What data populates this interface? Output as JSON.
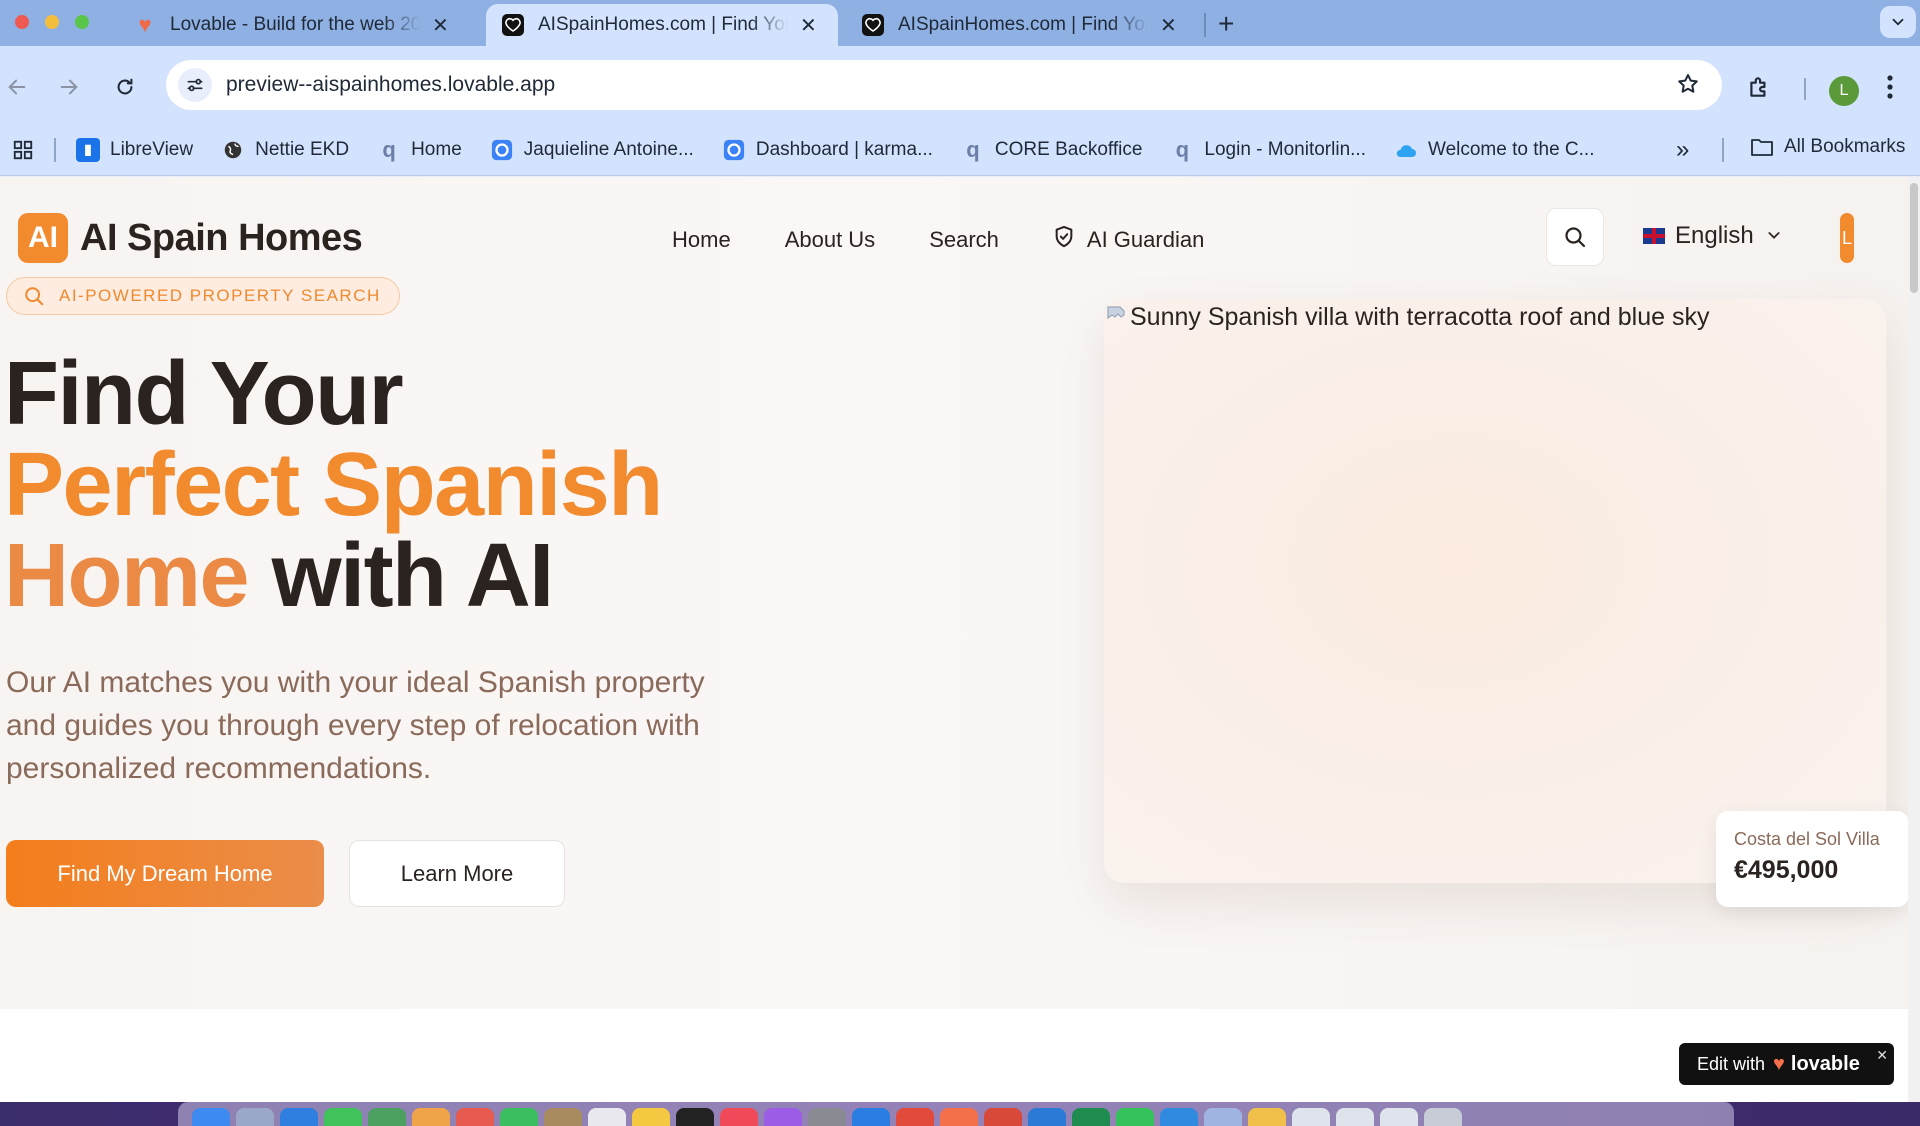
{
  "browser": {
    "tabs": [
      {
        "title": "Lovable - Build for the web 20",
        "active": false,
        "favicon": "lovable-heart-icon"
      },
      {
        "title": "AISpainHomes.com | Find You",
        "active": true,
        "favicon": "heart-outline-icon"
      },
      {
        "title": "AISpainHomes.com | Find You",
        "active": false,
        "favicon": "heart-outline-icon"
      }
    ],
    "url": "preview--aispainhomes.lovable.app",
    "profile_initial": "L",
    "bookmarks": [
      {
        "label": "LibreView",
        "icon": "libreview-icon",
        "color": "#1a73e8"
      },
      {
        "label": "Nettie EKD",
        "icon": "globe-icon",
        "color": "#333333"
      },
      {
        "label": "Home",
        "icon": "q-icon",
        "color": "#6b7fa8"
      },
      {
        "label": "Jaquieline Antoine...",
        "icon": "circle-icon",
        "color": "#3b82f6"
      },
      {
        "label": "Dashboard | karma...",
        "icon": "circle-icon",
        "color": "#3b82f6"
      },
      {
        "label": "CORE Backoffice",
        "icon": "q-icon",
        "color": "#6b7fa8"
      },
      {
        "label": "Login - Monitorlin...",
        "icon": "q-icon",
        "color": "#6b7fa8"
      },
      {
        "label": "Welcome to the C...",
        "icon": "cloud-icon",
        "color": "#2ea3f2"
      }
    ],
    "bookmarks_more": "»",
    "all_bookmarks": "All Bookmarks"
  },
  "site": {
    "logo_mark": "AI",
    "logo_text": "AI Spain Homes",
    "nav": {
      "home": "Home",
      "about": "About Us",
      "search": "Search",
      "guardian": "AI Guardian"
    },
    "language": "English",
    "user_initial": "L"
  },
  "hero": {
    "badge": "AI-POWERED PROPERTY SEARCH",
    "title_line1": "Find Your",
    "title_line2": "Perfect Spanish",
    "title_line3_accent": "Home",
    "title_line3_rest": " with AI",
    "subtitle": "Our AI matches you with your ideal Spanish property and guides you through every step of relocation with personalized recommendations.",
    "primary_cta": "Find My Dream Home",
    "secondary_cta": "Learn More",
    "image_alt": "Sunny Spanish villa with terracotta roof and blue sky",
    "property_card": {
      "name": "Costa del Sol Villa",
      "price": "€495,000"
    }
  },
  "lovable_badge": {
    "prefix": "Edit with",
    "brand": "lovable",
    "close": "✕"
  },
  "colors": {
    "accent": "#f28a2e",
    "text_dark": "#2a2320",
    "text_muted": "#8a6a5a"
  }
}
